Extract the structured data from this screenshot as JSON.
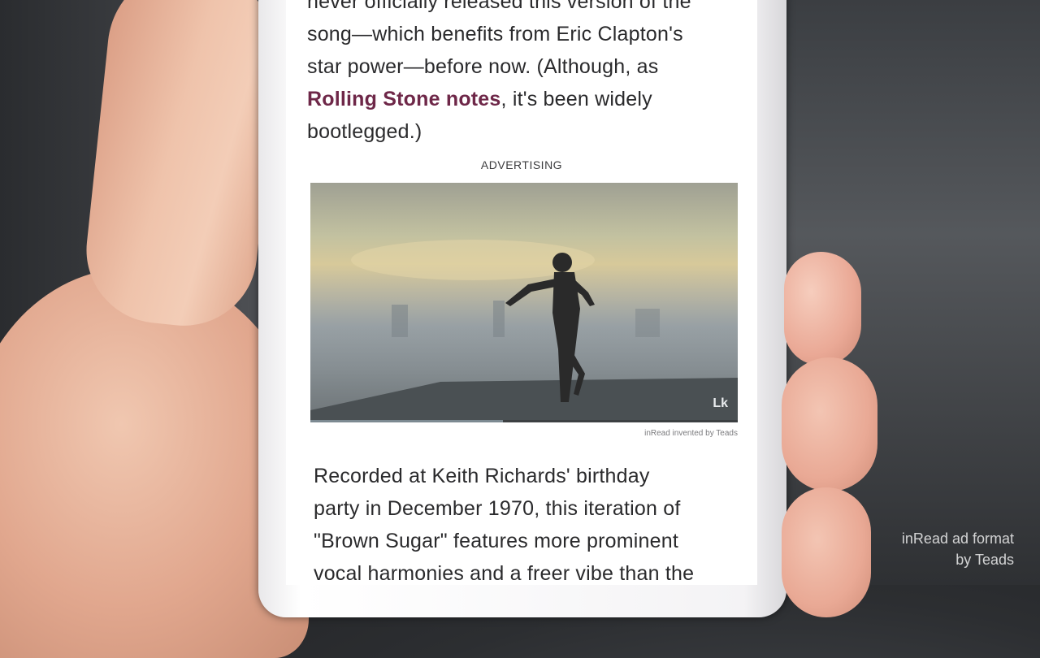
{
  "article": {
    "paragraph_top_lines": [
      "never officially released this version of the",
      "song—which benefits from Eric Clapton's",
      "star power—before now. (Although, as"
    ],
    "paragraph_top_link": "Rolling Stone notes",
    "paragraph_top_line4_rest": ", it's been widely",
    "paragraph_top_line5": "bootlegged.)",
    "paragraph_bottom_lines": [
      "Recorded at Keith Richards' birthday",
      "party in December 1970, this iteration of",
      "\"Brown Sugar\" features more prominent",
      "vocal harmonies and a freer vibe than the"
    ]
  },
  "ad": {
    "label": "ADVERTISING",
    "logo": "Lk",
    "credit": "inRead invented by Teads",
    "progress": 0.45
  },
  "watermark": {
    "line1": "inRead ad format",
    "line2": "by Teads"
  }
}
